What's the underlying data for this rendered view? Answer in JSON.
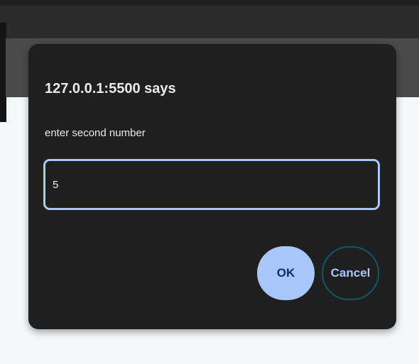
{
  "dialog": {
    "title": "127.0.0.1:5500 says",
    "message": "enter second number",
    "input_value": "5",
    "ok_label": "OK",
    "cancel_label": "Cancel"
  },
  "colors": {
    "dialog_bg": "#1f1f1f",
    "accent": "#a8c7fa",
    "ok_text": "#062e6f",
    "cancel_border": "#0b5a66"
  }
}
